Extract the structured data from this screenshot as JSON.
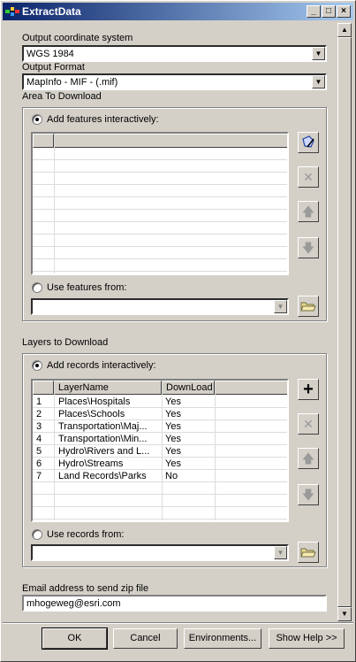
{
  "window": {
    "title": "ExtractData",
    "minimize": "_",
    "maximize": "□",
    "close": "×"
  },
  "output_cs": {
    "label": "Output coordinate system",
    "value": "WGS 1984"
  },
  "output_format": {
    "label": "Output Format",
    "value": "MapInfo - MIF - (.mif)"
  },
  "area": {
    "label": "Area To Download",
    "radio_interactive": "Add features interactively:",
    "radio_from": "Use features from:"
  },
  "layers": {
    "label": "Layers to Download",
    "radio_interactive": "Add records interactively:",
    "radio_from": "Use records from:",
    "columns": [
      "LayerName",
      "DownLoad"
    ],
    "rows": [
      {
        "num": "1",
        "name": "Places\\Hospitals",
        "download": "Yes"
      },
      {
        "num": "2",
        "name": "Places\\Schools",
        "download": "Yes"
      },
      {
        "num": "3",
        "name": "Transportation\\Maj...",
        "download": "Yes"
      },
      {
        "num": "4",
        "name": "Transportation\\Min...",
        "download": "Yes"
      },
      {
        "num": "5",
        "name": "Hydro\\Rivers and L...",
        "download": "Yes"
      },
      {
        "num": "6",
        "name": "Hydro\\Streams",
        "download": "Yes"
      },
      {
        "num": "7",
        "name": "Land Records\\Parks",
        "download": "No"
      }
    ]
  },
  "email": {
    "label": "Email address to send zip file",
    "value": "mhogeweg@esri.com"
  },
  "buttons": {
    "ok": "OK",
    "cancel": "Cancel",
    "environments": "Environments...",
    "help": "Show Help >>"
  }
}
